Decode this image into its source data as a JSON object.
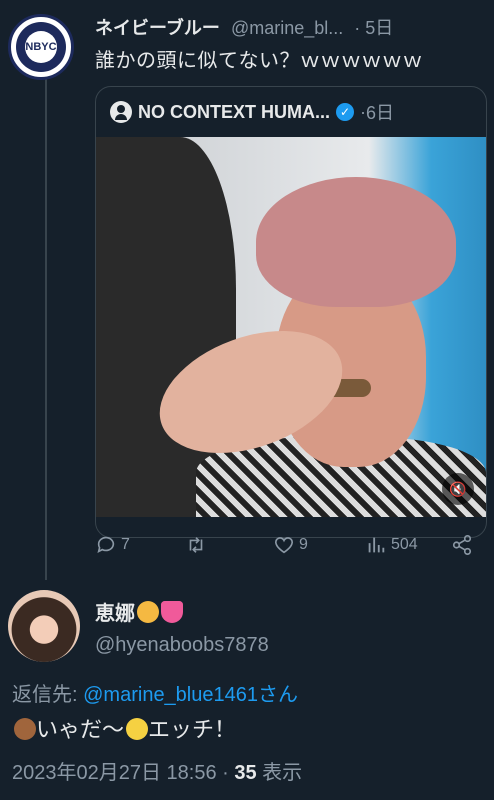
{
  "tweet": {
    "display_name": "ネイビーブルー",
    "handle": "@marine_bl...",
    "dot": "·",
    "time": "5日",
    "text": "誰かの頭に似てない？ｗｗｗｗｗｗ",
    "avatar_ring_text": "Navy Blue YouTube Channel",
    "avatar_logo": "NBYC"
  },
  "quote": {
    "name": "NO CONTEXT HUMA...",
    "dot": "·",
    "time": "6日",
    "verified_icon": "verified-badge-icon"
  },
  "actions": {
    "replies": "7",
    "retweets": "",
    "likes": "9",
    "views": "504"
  },
  "reply": {
    "display_name": "恵娜",
    "handle": "@hyenaboobs7878",
    "reply_to_label": "返信先: ",
    "reply_to_link": "@marine_blue1461さん",
    "text_part1": "いゃだ〜",
    "text_part2": "エッチ！",
    "timestamp": "2023年02月27日 18:56 · ",
    "view_count": "35",
    "view_label": " 表示"
  },
  "colors": {
    "background": "#15202b",
    "accent": "#1d9bf0",
    "muted": "#8b98a5",
    "text": "#e7e9ea"
  }
}
